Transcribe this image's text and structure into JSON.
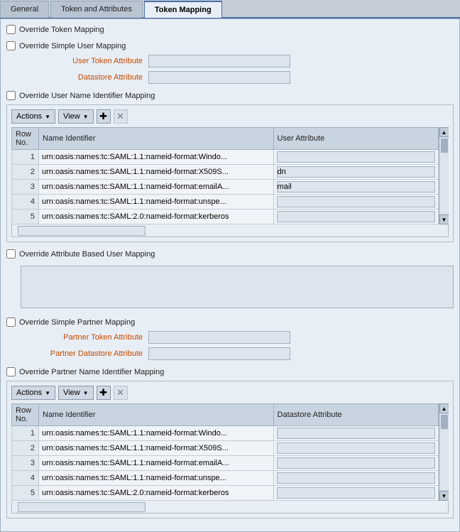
{
  "tabs": [
    {
      "id": "general",
      "label": "General",
      "active": false
    },
    {
      "id": "token-attributes",
      "label": "Token and Attributes",
      "active": false
    },
    {
      "id": "token-mapping",
      "label": "Token Mapping",
      "active": true
    }
  ],
  "overrideTokenMapping": "Override Token Mapping",
  "sections": {
    "simpleUserMapping": {
      "checkboxLabel": "Override Simple User Mapping",
      "fields": [
        {
          "label": "User Token Attribute",
          "value": ""
        },
        {
          "label": "Datastore Attribute",
          "value": ""
        }
      ]
    },
    "userNameIdentifierMapping": {
      "checkboxLabel": "Override User Name Identifier Mapping",
      "toolbar": {
        "actionsLabel": "Actions",
        "viewLabel": "View",
        "addTitle": "+",
        "deleteTitle": "✕"
      },
      "table": {
        "columns": [
          "Row No.",
          "Name Identifier",
          "User Attribute"
        ],
        "rows": [
          {
            "no": 1,
            "name": "urn:oasis:names:tc:SAML:1.1:nameid-format:Windo...",
            "attr": ""
          },
          {
            "no": 2,
            "name": "urn:oasis:names:tc:SAML:1.1:nameid-format:X509S...",
            "attr": "dn"
          },
          {
            "no": 3,
            "name": "urn:oasis:names:tc:SAML:1.1:nameid-format:emailA...",
            "attr": "mail"
          },
          {
            "no": 4,
            "name": "urn:oasis:names:tc:SAML:1.1:nameid-format:unspe...",
            "attr": ""
          },
          {
            "no": 5,
            "name": "urn:oasis:names:tc:SAML:2.0:nameid-format:kerberos",
            "attr": ""
          }
        ]
      }
    },
    "attributeBasedUserMapping": {
      "checkboxLabel": "Override Attribute Based User Mapping",
      "textareaPlaceholder": ""
    },
    "simplePartnerMapping": {
      "checkboxLabel": "Override Simple Partner Mapping",
      "fields": [
        {
          "label": "Partner Token Attribute",
          "value": ""
        },
        {
          "label": "Partner Datastore Attribute",
          "value": ""
        }
      ]
    },
    "partnerNameIdentifierMapping": {
      "checkboxLabel": "Override Partner Name Identifier Mapping",
      "toolbar": {
        "actionsLabel": "Actions",
        "viewLabel": "View",
        "addTitle": "+",
        "deleteTitle": "✕"
      },
      "table": {
        "columns": [
          "Row No.",
          "Name Identifier",
          "Datastore Attribute"
        ],
        "rows": [
          {
            "no": 1,
            "name": "urn:oasis:names:tc:SAML:1.1:nameid-format:Windo...",
            "attr": ""
          },
          {
            "no": 2,
            "name": "urn:oasis:names:tc:SAML:1.1:nameid-format:X509S...",
            "attr": ""
          },
          {
            "no": 3,
            "name": "urn:oasis:names:tc:SAML:1.1:nameid-format:emailA...",
            "attr": ""
          },
          {
            "no": 4,
            "name": "urn:oasis:names:tc:SAML:1.1:nameid-format:unspe...",
            "attr": ""
          },
          {
            "no": 5,
            "name": "urn:oasis:names:tc:SAML:2.0:nameid-format:kerberos",
            "attr": ""
          }
        ]
      }
    }
  }
}
